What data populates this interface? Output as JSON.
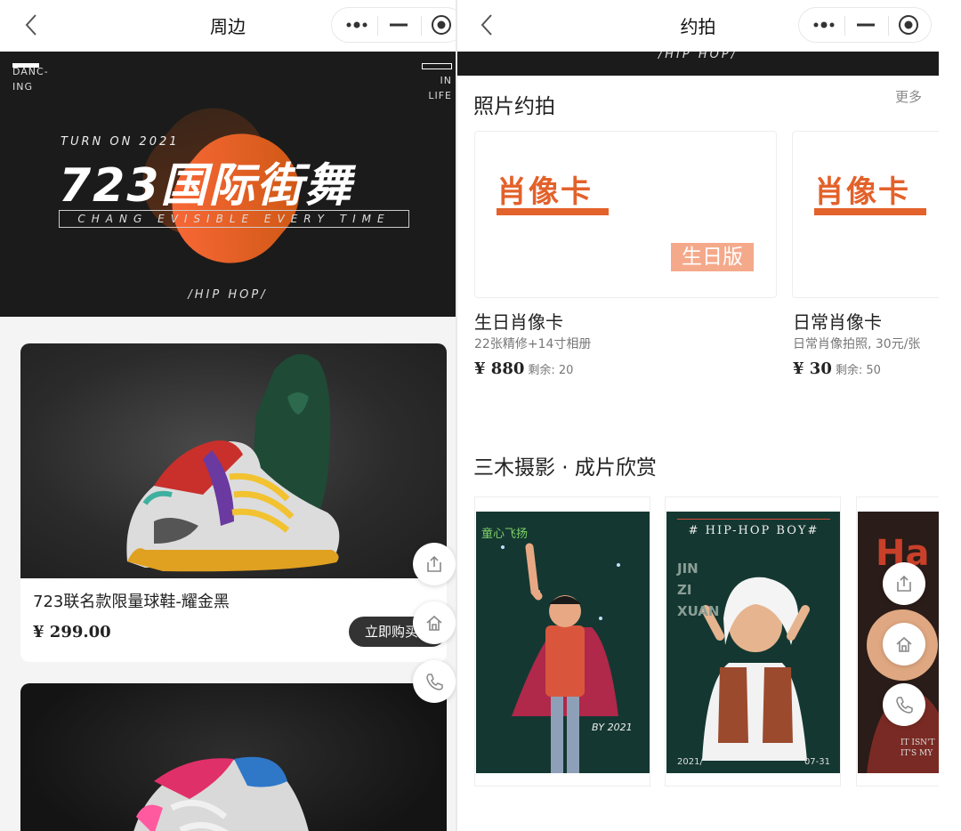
{
  "left": {
    "nav": {
      "title": "周边"
    },
    "banner": {
      "corner_left": "DANC-\nING",
      "corner_right": "IN\nLIFE",
      "turn": "TURN ON 2021",
      "headline": "723国际街舞",
      "sub": "CHANG EVISIBLE EVERY TIME",
      "genre": "/HIP HOP/"
    },
    "products": [
      {
        "name": "723联名款限量球鞋-耀金黑",
        "price": "¥ 299.00",
        "buy_label": "立即购买"
      }
    ]
  },
  "right": {
    "nav": {
      "title": "约拍"
    },
    "strip": "/HIP HOP/",
    "section1": {
      "title": "照片约拍",
      "more": "更多",
      "cards": [
        {
          "logo": "肖像卡",
          "tag": "生日版",
          "name": "生日肖像卡",
          "desc": "22张精修+14寸相册",
          "price": "¥ 880",
          "left": "剩余: 20"
        },
        {
          "logo": "肖像卡",
          "tag": "",
          "name": "日常肖像卡",
          "desc": "日常肖像拍照, 30元/张",
          "price": "¥ 30",
          "left": "剩余: 50"
        }
      ]
    },
    "section2": {
      "title": "三木摄影 · 成片欣赏",
      "photos": [
        {
          "caption_top": "童心飞扬",
          "caption_bottom": "BY 2021"
        },
        {
          "caption_top": "# HIP-HOP BOY#",
          "side_text": "JIN\nZI\nXUAN",
          "bottom_left": "2021/",
          "bottom_right": "07-31"
        },
        {
          "caption_top": "",
          "bottom_right": "IT ISN'T\nIT'S MY"
        }
      ]
    }
  },
  "colors": {
    "accent": "#e3612b",
    "dark": "#1b1b1b",
    "tag": "#f5a98b"
  },
  "icons": [
    "chevron-left-icon",
    "more-dots-icon",
    "minimize-icon",
    "target-icon",
    "share-icon",
    "home-icon",
    "phone-icon"
  ]
}
